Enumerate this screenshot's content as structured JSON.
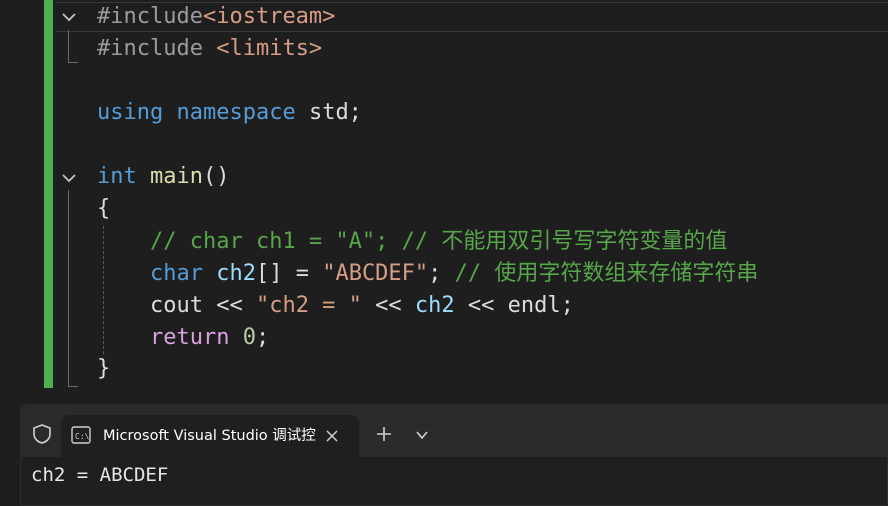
{
  "editor": {
    "lines": [
      {
        "id": "line1",
        "tokens": [
          {
            "t": "#include",
            "c": "c-pre"
          },
          {
            "t": "<iostream>",
            "c": "c-hdr"
          }
        ]
      },
      {
        "id": "line2",
        "tokens": [
          {
            "t": "#include ",
            "c": "c-pre"
          },
          {
            "t": "<limits>",
            "c": "c-hdr"
          }
        ]
      },
      {
        "id": "line3",
        "tokens": []
      },
      {
        "id": "line4",
        "tokens": [
          {
            "t": "using",
            "c": "c-kw"
          },
          {
            "t": " ",
            "c": "c-pl"
          },
          {
            "t": "namespace",
            "c": "c-kw"
          },
          {
            "t": " std;",
            "c": "c-pl"
          }
        ]
      },
      {
        "id": "line5",
        "tokens": []
      },
      {
        "id": "line6",
        "tokens": [
          {
            "t": "int",
            "c": "c-kw"
          },
          {
            "t": " ",
            "c": "c-pl"
          },
          {
            "t": "main",
            "c": "c-fn"
          },
          {
            "t": "()",
            "c": "c-pl"
          }
        ]
      },
      {
        "id": "line7",
        "tokens": [
          {
            "t": "{",
            "c": "c-pl"
          }
        ]
      },
      {
        "id": "line8",
        "tokens": [
          {
            "t": "    ",
            "c": "c-pl"
          },
          {
            "t": "// char ch1 = \"A\"; // 不能用双引号写字符变量的值",
            "c": "c-cmt"
          }
        ]
      },
      {
        "id": "line9",
        "tokens": [
          {
            "t": "    ",
            "c": "c-pl"
          },
          {
            "t": "char",
            "c": "c-kw"
          },
          {
            "t": " ",
            "c": "c-pl"
          },
          {
            "t": "ch2",
            "c": "c-var"
          },
          {
            "t": "[] = ",
            "c": "c-pl"
          },
          {
            "t": "\"ABCDEF\"",
            "c": "c-str"
          },
          {
            "t": "; ",
            "c": "c-pl"
          },
          {
            "t": "// 使用字符数组来存储字符串",
            "c": "c-cmt"
          }
        ]
      },
      {
        "id": "line10",
        "tokens": [
          {
            "t": "    ",
            "c": "c-pl"
          },
          {
            "t": "cout << ",
            "c": "c-pl"
          },
          {
            "t": "\"ch2 = \"",
            "c": "c-str"
          },
          {
            "t": " << ",
            "c": "c-pl"
          },
          {
            "t": "ch2",
            "c": "c-var"
          },
          {
            "t": " << endl;",
            "c": "c-pl"
          }
        ]
      },
      {
        "id": "line11",
        "tokens": [
          {
            "t": "    ",
            "c": "c-pl"
          },
          {
            "t": "return",
            "c": "c-ctrl"
          },
          {
            "t": " ",
            "c": "c-pl"
          },
          {
            "t": "0",
            "c": "c-num"
          },
          {
            "t": ";",
            "c": "c-pl"
          }
        ]
      },
      {
        "id": "line12",
        "tokens": [
          {
            "t": "}",
            "c": "c-pl"
          }
        ]
      }
    ]
  },
  "terminal": {
    "tab_title": "Microsoft Visual Studio 调试控",
    "output": "ch2 = ABCDEF",
    "icons": {
      "shield": "shield-icon",
      "tab": "console-icon",
      "close": "close-icon",
      "new_tab": "plus-icon",
      "dropdown": "chevron-down-icon"
    }
  },
  "colors": {
    "background": "#1e1e1e",
    "change_bar": "#4caf50",
    "keyword": "#569cd6",
    "comment": "#57a64a",
    "string": "#d69d85",
    "function": "#dcdcaa",
    "variable": "#9cdcfe",
    "control": "#d8a0df",
    "number": "#b5cea8"
  }
}
